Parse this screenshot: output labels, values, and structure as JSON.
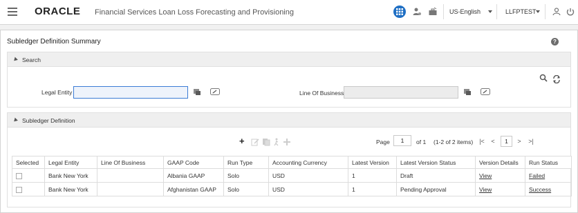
{
  "header": {
    "logo": "ORACLE",
    "app_title": "Financial Services Loan Loss Forecasting and Provisioning",
    "language": "US-English",
    "user": "LLFPTEST"
  },
  "page": {
    "title": "Subledger Definition Summary",
    "help": "?"
  },
  "search": {
    "title": "Search",
    "legal_entity_label": "Legal Entity",
    "legal_entity_value": "",
    "lob_label": "Line Of Business",
    "lob_value": ""
  },
  "definition": {
    "title": "Subledger Definition",
    "pager": {
      "page_label": "Page",
      "page_value": "1",
      "of_label": "of 1",
      "items_label": "(1-2 of 2 items)",
      "current": "1"
    },
    "columns": [
      "Selected",
      "Legal Entity",
      "Line Of Business",
      "GAAP Code",
      "Run Type",
      "Accounting Currency",
      "Latest Version",
      "Latest Version Status",
      "Version Details",
      "Run Status"
    ],
    "rows": [
      {
        "legal_entity": "Bank New York",
        "lob": "",
        "gaap": "Albania GAAP",
        "run_type": "Solo",
        "currency": "USD",
        "version": "1",
        "status": "Draft",
        "details": "View",
        "run_status": "Failed"
      },
      {
        "legal_entity": "Bank New York",
        "lob": "",
        "gaap": "Afghanistan GAAP",
        "run_type": "Solo",
        "currency": "USD",
        "version": "1",
        "status": "Pending Approval",
        "details": "View",
        "run_status": "Success"
      }
    ]
  },
  "icons": {
    "accent": "#1f6fc4"
  }
}
